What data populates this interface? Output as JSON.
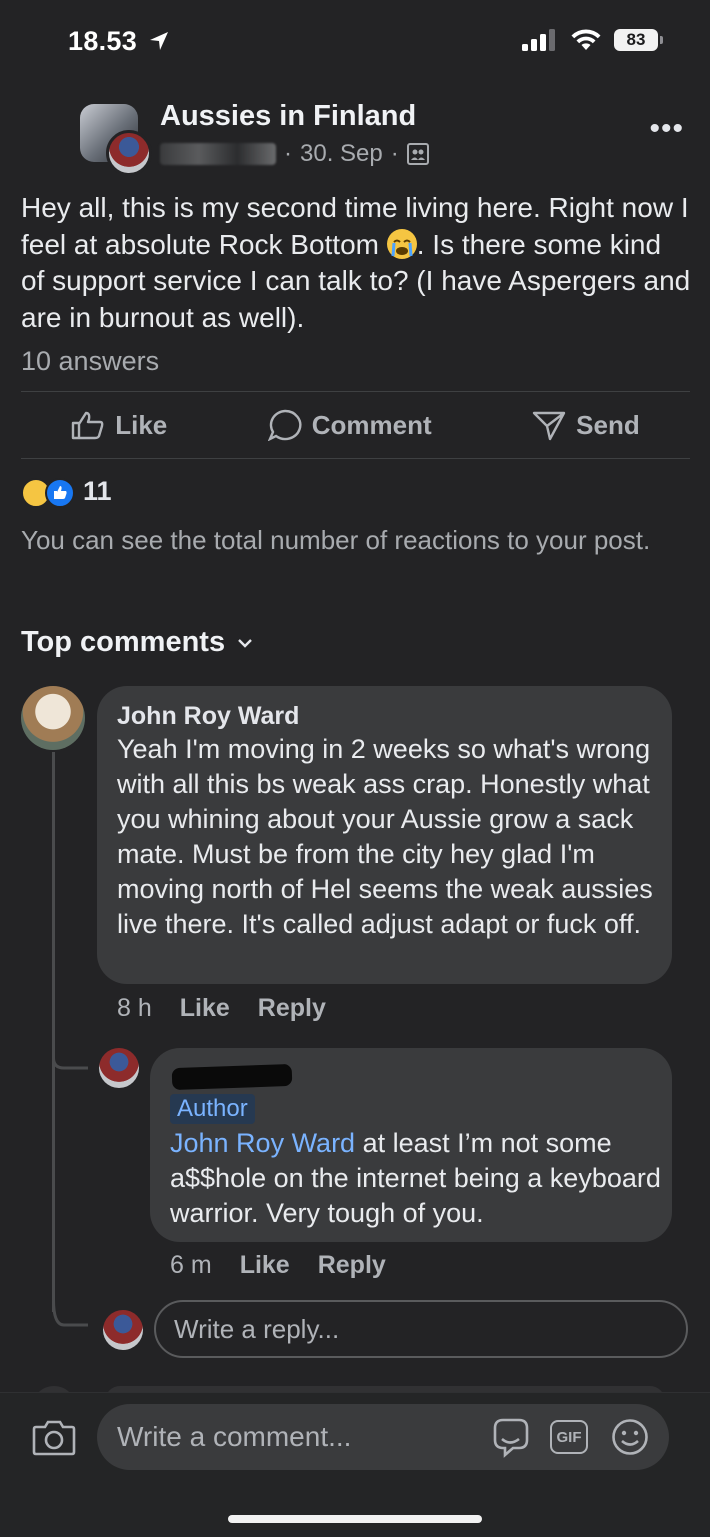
{
  "status_bar": {
    "time": "18.53",
    "battery": "83"
  },
  "post": {
    "group_name": "Aussies in Finland",
    "date": "30. Sep",
    "body_part1": "Hey all, this is my second time living here. Right now I feel at absolute Rock Bottom ",
    "body_part2": ". Is there some kind of support service I can talk to? (I have Aspergers and are in burnout as well).",
    "answers": "10 answers",
    "actions": {
      "like": "Like",
      "comment": "Comment",
      "send": "Send"
    },
    "reaction_count": "11",
    "reactions_note": "You can see the total number of reactions to your post."
  },
  "comments_header": "Top comments",
  "comments": [
    {
      "name": "John Roy Ward",
      "text": "Yeah I'm moving in 2 weeks so what's wrong with all this bs weak ass crap. Honestly what you whining about your Aussie grow a sack mate. Must be from the city hey glad I'm moving north of Hel seems the weak aussies live there. It's called adjust adapt or fuck off.",
      "time": "8 h",
      "like": "Like",
      "reply": "Reply"
    }
  ],
  "reply": {
    "badge": "Author",
    "mention": "John Roy Ward",
    "text": " at least I’m not some a$$hole on the internet being a keyboard warrior. Very tough of you.",
    "time": "6 m",
    "like": "Like",
    "reply": "Reply"
  },
  "reply_placeholder": "Write a reply...",
  "composer": {
    "placeholder": "Write a comment...",
    "gif_label": "GIF"
  }
}
